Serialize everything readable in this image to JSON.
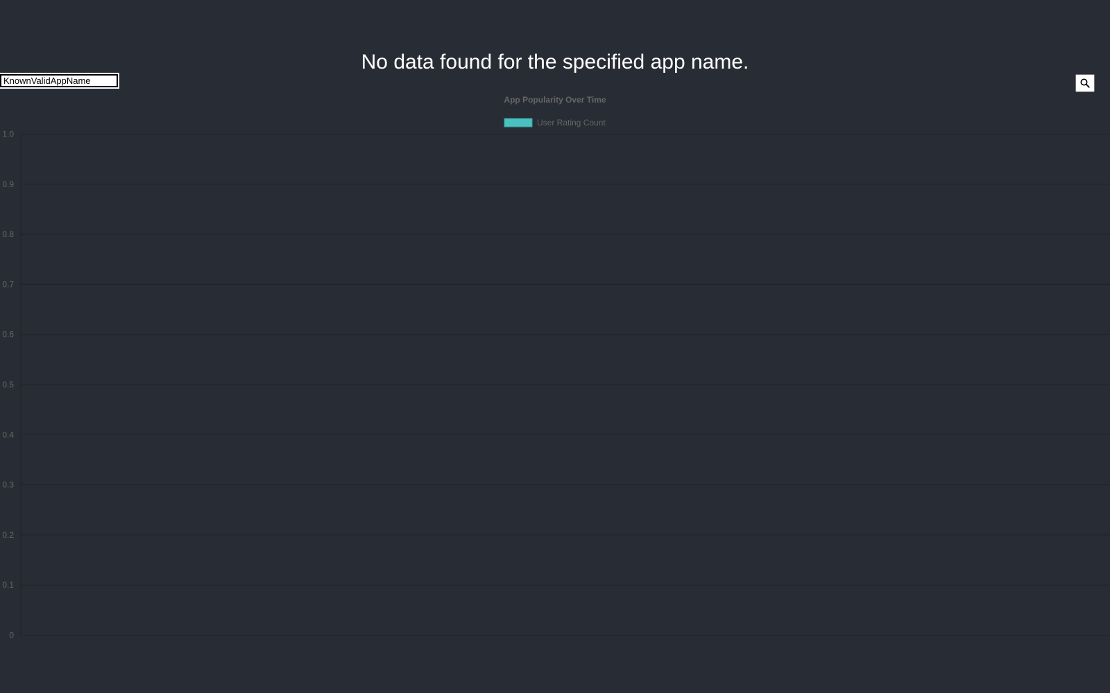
{
  "message": "No data found for the specified app name.",
  "search": {
    "value": "KnownValidAppName",
    "button_icon": "search-icon"
  },
  "chart_data": {
    "type": "bar",
    "title": "App Popularity Over Time",
    "series": [
      {
        "name": "User Rating Count",
        "values": [],
        "color": "#4bc0c0"
      }
    ],
    "categories": [],
    "yticks": [
      "0",
      "0.1",
      "0.2",
      "0.3",
      "0.4",
      "0.5",
      "0.6",
      "0.7",
      "0.8",
      "0.9",
      "1.0"
    ],
    "ylim": [
      0,
      1
    ],
    "legend_position": "top",
    "grid": true
  },
  "colors": {
    "background": "#282c34",
    "message_text": "#ffffff",
    "chart_text": "#666666",
    "grid": "#1f2329",
    "series": "#4bc0c0"
  }
}
